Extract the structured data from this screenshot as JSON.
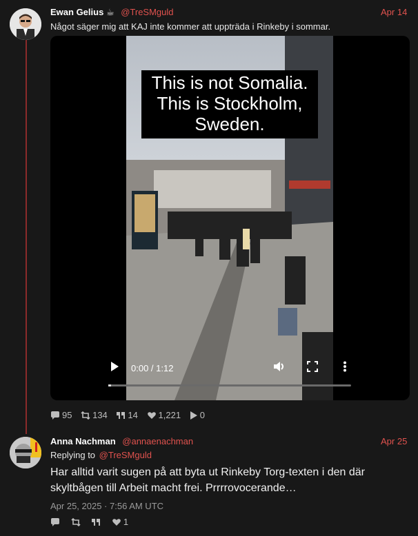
{
  "post1": {
    "name": "Ewan Gelius",
    "name_emoji": "☕",
    "handle": "@TreSMguld",
    "date": "Apr 14",
    "text": "Något säger mig att KAJ inte kommer att uppträda i Rinkeby i sommar.",
    "video": {
      "caption_lines": [
        "This is not Somalia.",
        "This is Stockholm,",
        "Sweden."
      ],
      "time": "0:00 / 1:12",
      "progress": 0.0
    },
    "stats": {
      "replies": "95",
      "retweets": "134",
      "quotes": "14",
      "likes": "1,221",
      "views": "0"
    }
  },
  "post2": {
    "name": "Anna Nachman",
    "handle": "@annaenachman",
    "date": "Apr 25",
    "replying_label": "Replying to",
    "replying_handle": "@TreSMguld",
    "text": "Har alltid varit sugen på att byta ut Rinkeby Torg-texten i den där skyltbågen till Arbeit macht frei. Prrrrovocerande…",
    "timestamp": "Apr 25, 2025 · 7:56 AM UTC",
    "stats": {
      "likes": "1"
    }
  },
  "colors": {
    "accent": "#e0524e",
    "thread_line": "#8b2a2a",
    "background": "#181818"
  },
  "icons": [
    "comment-icon",
    "retweet-icon",
    "quote-icon",
    "heart-icon",
    "play-icon",
    "volume-icon",
    "fullscreen-icon",
    "more-vertical-icon"
  ]
}
